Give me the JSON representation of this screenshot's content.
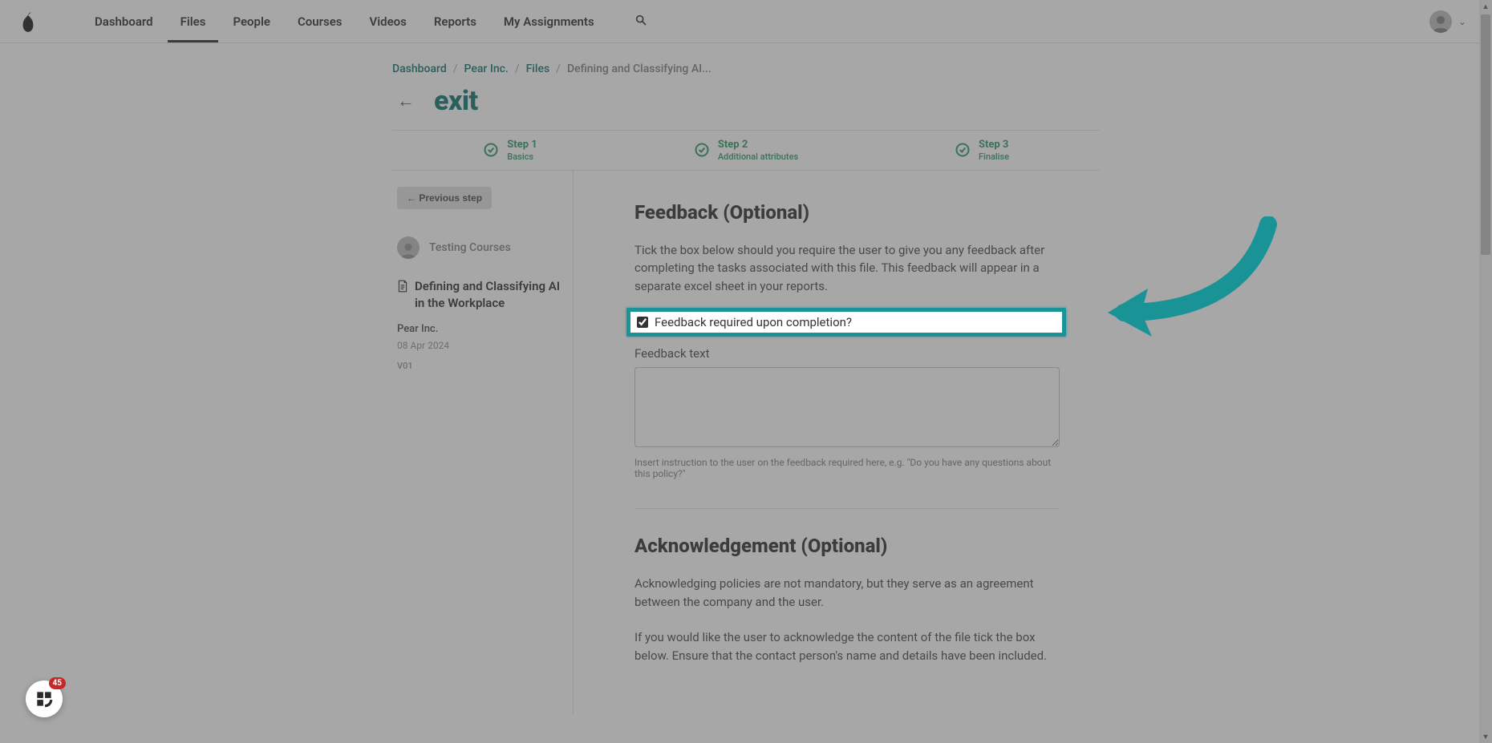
{
  "nav": {
    "items": [
      "Dashboard",
      "Files",
      "People",
      "Courses",
      "Videos",
      "Reports",
      "My Assignments"
    ],
    "active_index": 1
  },
  "breadcrumbs": {
    "items": [
      "Dashboard",
      "Pear Inc.",
      "Files"
    ],
    "current": "Defining and Classifying AI..."
  },
  "page": {
    "title": "exit"
  },
  "stepper": [
    {
      "label": "Step 1",
      "sub": "Basics"
    },
    {
      "label": "Step 2",
      "sub": "Additional attributes"
    },
    {
      "label": "Step 3",
      "sub": "Finalise"
    }
  ],
  "left": {
    "prev_button": "← Previous step",
    "user_name": "Testing Courses",
    "file_name": "Defining and Classifying AI in the Workplace",
    "company": "Pear Inc.",
    "date": "08 Apr 2024",
    "version": "V01"
  },
  "right": {
    "feedback_title": "Feedback (Optional)",
    "feedback_desc": "Tick the box below should you require the user to give you any feedback after completing the tasks associated with this file. This feedback will appear in a separate excel sheet in your reports.",
    "feedback_checkbox_label": "Feedback required upon completion?",
    "feedback_field_label": "Feedback text",
    "feedback_hint": "Insert instruction to the user on the feedback required here, e.g. \"Do you have any questions about this policy?\"",
    "ack_title": "Acknowledgement (Optional)",
    "ack_desc1": "Acknowledging policies are not mandatory, but they serve as an agreement between the company and the user.",
    "ack_desc2": "If you would like the user to acknowledge the content of the file tick the box below. Ensure that the contact person's name and details have been included."
  },
  "widget": {
    "badge": "45"
  },
  "colors": {
    "accent": "#1a9396",
    "teal_link": "#1c7c7a",
    "step_green": "#3aa06f"
  }
}
